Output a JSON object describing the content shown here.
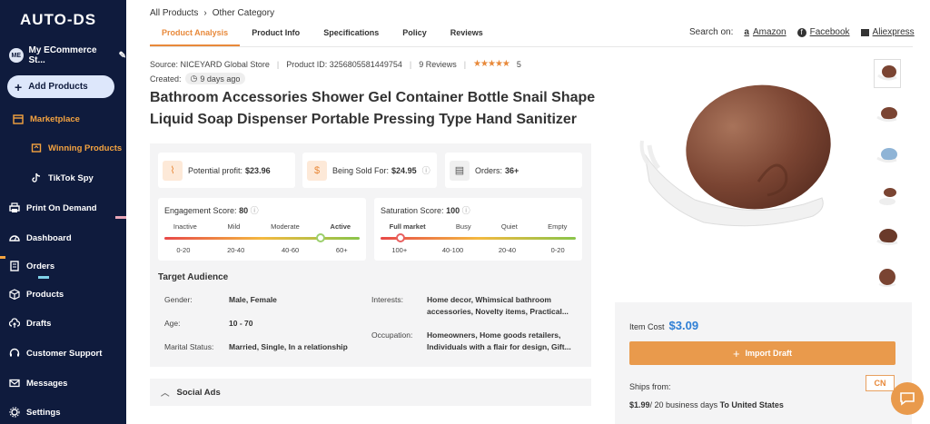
{
  "sidebar": {
    "logo": "AUTO-DS",
    "store_initials": "ME",
    "store_name": "My ECommerce St...",
    "add_products": "Add Products",
    "items": [
      {
        "label": "Marketplace",
        "icon": "store-icon"
      },
      {
        "label": "Winning Products",
        "icon": "trophy-icon"
      },
      {
        "label": "TikTok Spy",
        "icon": "tiktok-icon"
      },
      {
        "label": "Print On Demand",
        "icon": "print-icon"
      },
      {
        "label": "Dashboard",
        "icon": "dashboard-icon"
      },
      {
        "label": "Orders",
        "icon": "orders-icon"
      },
      {
        "label": "Products",
        "icon": "box-icon"
      },
      {
        "label": "Drafts",
        "icon": "cloud-upload-icon"
      },
      {
        "label": "Customer Support",
        "icon": "headset-icon"
      },
      {
        "label": "Messages",
        "icon": "mail-icon"
      },
      {
        "label": "Settings",
        "icon": "gear-icon"
      }
    ]
  },
  "breadcrumb": {
    "root": "All Products",
    "current": "Other Category"
  },
  "tabs": [
    "Product Analysis",
    "Product Info",
    "Specifications",
    "Policy",
    "Reviews"
  ],
  "search_on": {
    "label": "Search on:",
    "amazon": "Amazon",
    "facebook": "Facebook",
    "aliexpress": "Aliexpress"
  },
  "meta": {
    "source": "Source: NICEYARD Global Store",
    "product_id": "Product ID: 3256805581449754",
    "reviews": "9 Reviews",
    "stars": "★★★★★",
    "rating": "5",
    "created_label": "Created:",
    "created_value": "9 days ago"
  },
  "title": "Bathroom Accessories Shower Gel Container Bottle Snail Shape Liquid Soap Dispenser Portable Pressing Type Hand Sanitizer",
  "stats": {
    "profit_label": "Potential profit:",
    "profit_value": "$23.96",
    "sold_label": "Being Sold For:",
    "sold_value": "$24.95",
    "orders_label": "Orders:",
    "orders_value": "36+"
  },
  "engagement": {
    "label": "Engagement Score:",
    "value": "80",
    "levels": [
      "Inactive",
      "Mild",
      "Moderate",
      "Active"
    ],
    "ranges": [
      "0-20",
      "20-40",
      "40-60",
      "60+"
    ],
    "level": 0.8
  },
  "saturation": {
    "label": "Saturation Score:",
    "value": "100",
    "levels": [
      "Full market",
      "Busy",
      "Quiet",
      "Empty"
    ],
    "ranges": [
      "100+",
      "40-100",
      "20-40",
      "0-20"
    ],
    "level": 0.1
  },
  "audience": {
    "title": "Target Audience",
    "gender_label": "Gender:",
    "gender": "Male, Female",
    "age_label": "Age:",
    "age": "10 - 70",
    "marital_label": "Marital Status:",
    "marital": "Married, Single, In a relationship",
    "interests_label": "Interests:",
    "interests": "Home decor, Whimsical bathroom accessories, Novelty items, Practical...",
    "occupation_label": "Occupation:",
    "occupation": "Homeowners, Home goods retailers, Individuals with a flair for design, Gift..."
  },
  "social_ads": "Social Ads",
  "buy": {
    "item_cost_label": "Item Cost",
    "item_cost": "$3.09",
    "import_label": "Import Draft",
    "ships_from": "Ships from:",
    "country": "CN",
    "ship_price": "$1.99",
    "ship_days": "/ 20 business days",
    "ship_to": "To United States"
  },
  "colors": {
    "sidebar": "#0f1b3d",
    "accent": "#e8893a",
    "cost": "#2f7fd5"
  }
}
